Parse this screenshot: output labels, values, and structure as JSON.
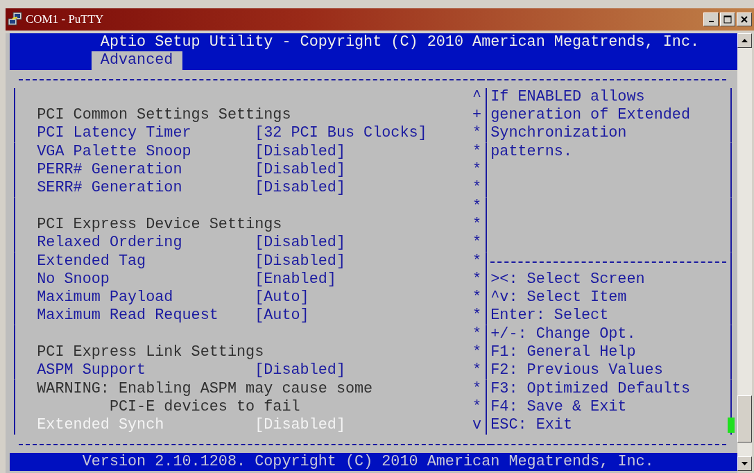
{
  "window": {
    "title": "COM1 - PuTTY"
  },
  "header": {
    "title": "Aptio Setup Utility - Copyright (C) 2010 American Megatrends, Inc."
  },
  "tabs": [
    {
      "label": "Advanced",
      "selected": true
    }
  ],
  "settings": [
    {
      "kind": "blank"
    },
    {
      "kind": "heading",
      "label": "PCI Common Settings Settings"
    },
    {
      "kind": "setting",
      "label": "PCI Latency Timer",
      "value": "[32 PCI Bus Clocks]",
      "selected": false
    },
    {
      "kind": "setting",
      "label": "VGA Palette Snoop",
      "value": "[Disabled]",
      "selected": false
    },
    {
      "kind": "setting",
      "label": "PERR# Generation",
      "value": "[Disabled]",
      "selected": false
    },
    {
      "kind": "setting",
      "label": "SERR# Generation",
      "value": "[Disabled]",
      "selected": false
    },
    {
      "kind": "blank"
    },
    {
      "kind": "heading",
      "label": "PCI Express Device Settings"
    },
    {
      "kind": "setting",
      "label": "Relaxed Ordering",
      "value": "[Disabled]",
      "selected": false
    },
    {
      "kind": "setting",
      "label": "Extended Tag",
      "value": "[Disabled]",
      "selected": false
    },
    {
      "kind": "setting",
      "label": "No Snoop",
      "value": "[Enabled]",
      "selected": false
    },
    {
      "kind": "setting",
      "label": "Maximum Payload",
      "value": "[Auto]",
      "selected": false
    },
    {
      "kind": "setting",
      "label": "Maximum Read Request",
      "value": "[Auto]",
      "selected": false
    },
    {
      "kind": "blank"
    },
    {
      "kind": "heading",
      "label": "PCI Express Link Settings"
    },
    {
      "kind": "setting",
      "label": "ASPM Support",
      "value": "[Disabled]",
      "selected": false
    },
    {
      "kind": "note",
      "label": "WARNING: Enabling ASPM may cause some"
    },
    {
      "kind": "note_continued",
      "label": "PCI-E devices to fail"
    },
    {
      "kind": "setting",
      "label": "Extended Synch",
      "value": "[Disabled]",
      "selected": true
    }
  ],
  "help_panel": [
    {
      "mark": "^",
      "kind": "text",
      "text": "If ENABLED allows"
    },
    {
      "mark": "+",
      "kind": "text",
      "text": "generation of Extended"
    },
    {
      "mark": "*",
      "kind": "text",
      "text": "Synchronization"
    },
    {
      "mark": "*",
      "kind": "text",
      "text": "patterns."
    },
    {
      "mark": "*",
      "kind": "blank"
    },
    {
      "mark": "*",
      "kind": "blank"
    },
    {
      "mark": "*",
      "kind": "blank"
    },
    {
      "mark": "*",
      "kind": "blank"
    },
    {
      "mark": "*",
      "kind": "blank"
    },
    {
      "mark": "*",
      "kind": "divider"
    },
    {
      "mark": "*",
      "kind": "key",
      "text": "><: Select Screen"
    },
    {
      "mark": "*",
      "kind": "key",
      "text": "^v: Select Item"
    },
    {
      "mark": "*",
      "kind": "key",
      "text": "Enter: Select"
    },
    {
      "mark": "*",
      "kind": "key",
      "text": "+/-: Change Opt."
    },
    {
      "mark": "*",
      "kind": "key",
      "text": "F1: General Help"
    },
    {
      "mark": "*",
      "kind": "key",
      "text": "F2: Previous Values"
    },
    {
      "mark": "*",
      "kind": "key",
      "text": "F3: Optimized Defaults"
    },
    {
      "mark": "*",
      "kind": "key",
      "text": "F4: Save & Exit"
    },
    {
      "mark": "v",
      "kind": "key",
      "text": "ESC: Exit"
    }
  ],
  "footer": {
    "text": "Version 2.10.1208. Copyright (C) 2010 American Megatrends, Inc."
  }
}
